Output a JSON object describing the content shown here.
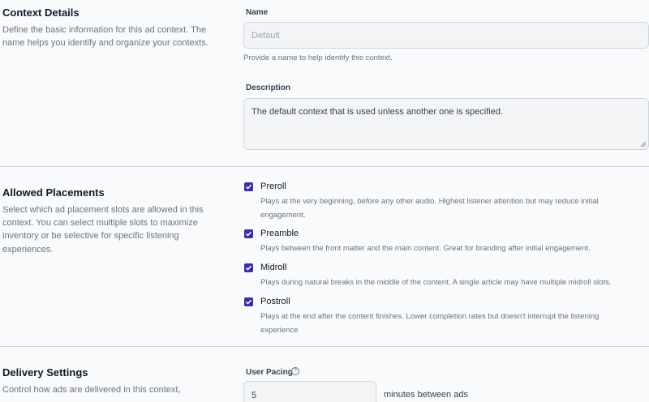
{
  "context_details": {
    "title": "Context Details",
    "description": "Define the basic information for this ad context. The name helps you identify and organize your contexts.",
    "name_label": "Name",
    "name_placeholder": "Default",
    "name_help": "Provide a name to help identify this context.",
    "description_label": "Description",
    "description_value": "The default context that is used unless another one is specified."
  },
  "allowed_placements": {
    "title": "Allowed Placements",
    "description": "Select which ad placement slots are allowed in this context. You can select multiple slots to maximize inventory or be selective for specific listening experiences.",
    "items": [
      {
        "label": "Preroll",
        "description": "Plays at the very beginning, before any other audio. Highest listener attention but may reduce initial engagement.",
        "checked": true
      },
      {
        "label": "Preamble",
        "description": "Plays between the front matter and the main content. Great for branding after initial engagement.",
        "checked": true
      },
      {
        "label": "Midroll",
        "description": "Plays during natural breaks in the middle of the content. A single article may have multiple midroll slots.",
        "checked": true
      },
      {
        "label": "Postroll",
        "description": "Plays at the end after the content finishes. Lower completion rates but doesn't interrupt the listening experience",
        "checked": true
      }
    ]
  },
  "delivery_settings": {
    "title": "Delivery Settings",
    "description": "Control how ads are delivered in this context,",
    "user_pacing_label": "User Pacing",
    "user_pacing_value": "5",
    "user_pacing_unit": "minutes between ads"
  },
  "colors": {
    "accent": "#3730a3",
    "background": "#f9fafb",
    "border": "#d1d5db"
  },
  "icons": {
    "checkbox": "check-icon",
    "info": "info-icon",
    "resize": "resize-grip-icon"
  }
}
